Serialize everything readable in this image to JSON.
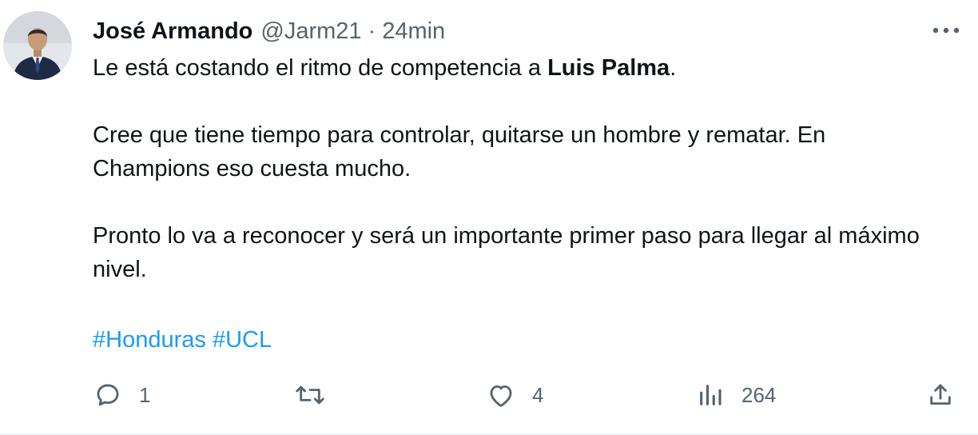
{
  "author": {
    "display_name": "José Armando",
    "handle": "@Jarm21",
    "separator": "·",
    "time": "24min"
  },
  "tweet": {
    "line1_prefix": "Le está costando el ritmo de competencia a ",
    "line1_mention": "Luis Palma",
    "line1_suffix": ".",
    "paragraph2": "Cree que tiene tiempo para controlar, quitarse un hombre y rematar. En Champions eso cuesta mucho.",
    "paragraph3": "Pronto lo va a reconocer y será un importante primer paso para llegar al máximo nivel.",
    "hashtags": [
      "#Honduras",
      "#UCL"
    ]
  },
  "actions": {
    "reply_count": "1",
    "retweet_count": "",
    "like_count": "4",
    "views_count": "264"
  },
  "icons": {
    "more": "more-horizontal-icon",
    "reply": "reply-icon",
    "retweet": "retweet-icon",
    "like": "heart-icon",
    "views": "views-icon",
    "share": "share-icon"
  },
  "colors": {
    "text": "#0f1419",
    "secondary": "#536471",
    "link": "#1d9bf0"
  }
}
